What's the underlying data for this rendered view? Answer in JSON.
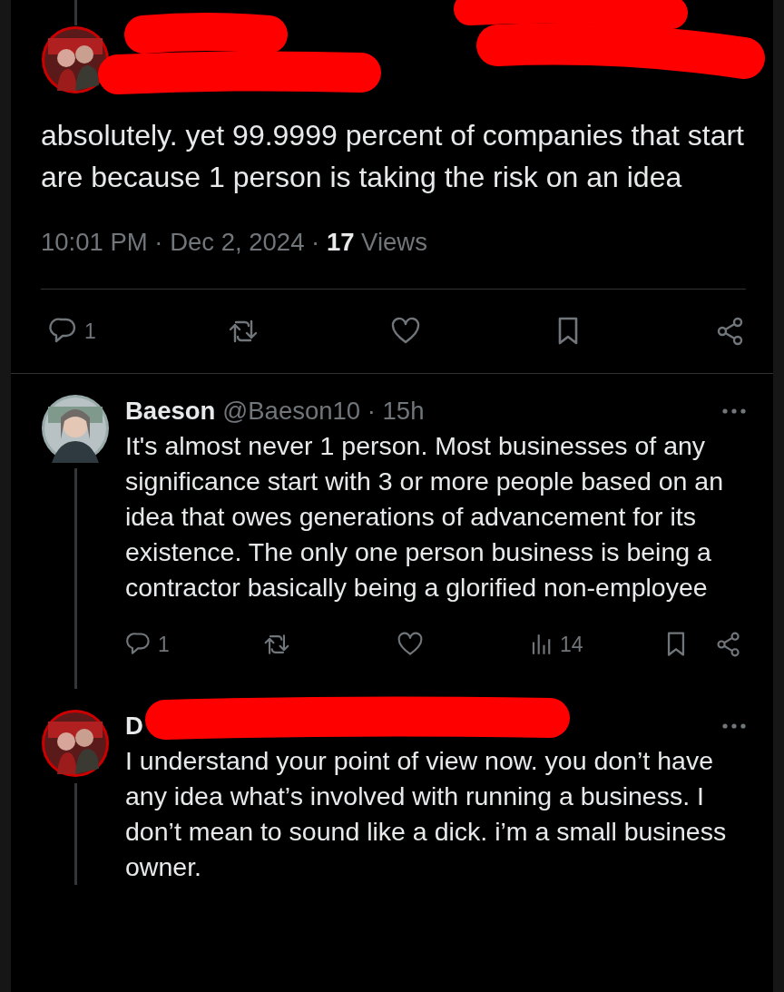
{
  "main_post": {
    "author_redacted": true,
    "text": "absolutely. yet 99.9999 percent of companies that start are because 1 person is taking the risk on an idea",
    "meta": "10:01 PM · Dec 2, 2024 · **17** Views",
    "reply_count": "1"
  },
  "replies": [
    {
      "author_redacted": false,
      "name": "Baeson",
      "meta": "@Baeson10 · 15h",
      "text": "It's almost never 1 person. Most businesses of any significance start with 3 or more people based on an idea that owes generations of advancement for its existence. The only one person business is being a contractor basically being a glorified non-employee",
      "reply_count": "1",
      "views": "14"
    },
    {
      "author_redacted": true,
      "name": "D",
      "text": "I understand your point of view now. you don’t have any idea what’s  involved with running a business. I don’t mean to sound like a dick. i’m a small business owner."
    }
  ]
}
